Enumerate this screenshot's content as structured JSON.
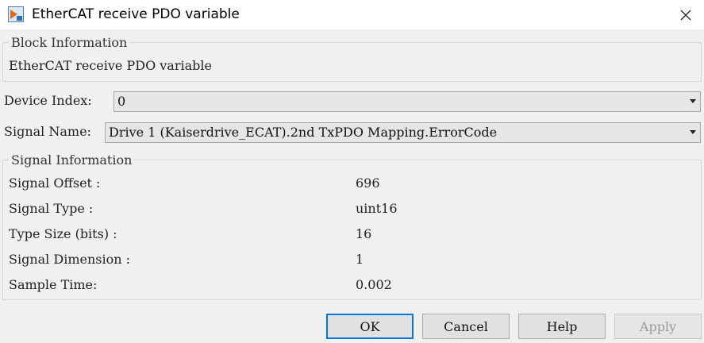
{
  "window": {
    "title": "EtherCAT receive PDO variable"
  },
  "block_info": {
    "legend": "Block Information",
    "description": "EtherCAT receive PDO variable"
  },
  "device_index": {
    "label": "Device Index:",
    "value": "0"
  },
  "signal_name": {
    "label": "Signal Name:",
    "value": "Drive 1 (Kaiserdrive_ECAT).2nd TxPDO Mapping.ErrorCode"
  },
  "signal_info": {
    "legend": "Signal Information",
    "rows": [
      {
        "label": "Signal Offset :",
        "value": "696"
      },
      {
        "label": "Signal Type :",
        "value": "uint16"
      },
      {
        "label": "Type Size (bits) :",
        "value": "16"
      },
      {
        "label": "Signal Dimension :",
        "value": "1"
      },
      {
        "label": "Sample Time:",
        "value": "0.002"
      }
    ]
  },
  "buttons": {
    "ok": "OK",
    "cancel": "Cancel",
    "help": "Help",
    "apply": "Apply"
  },
  "icons": {
    "app": "simulink-block-icon",
    "close": "close-icon",
    "dropdown": "chevron-down-icon"
  },
  "colors": {
    "default_button_border": "#0078d7",
    "background": "#f0f0f0"
  }
}
